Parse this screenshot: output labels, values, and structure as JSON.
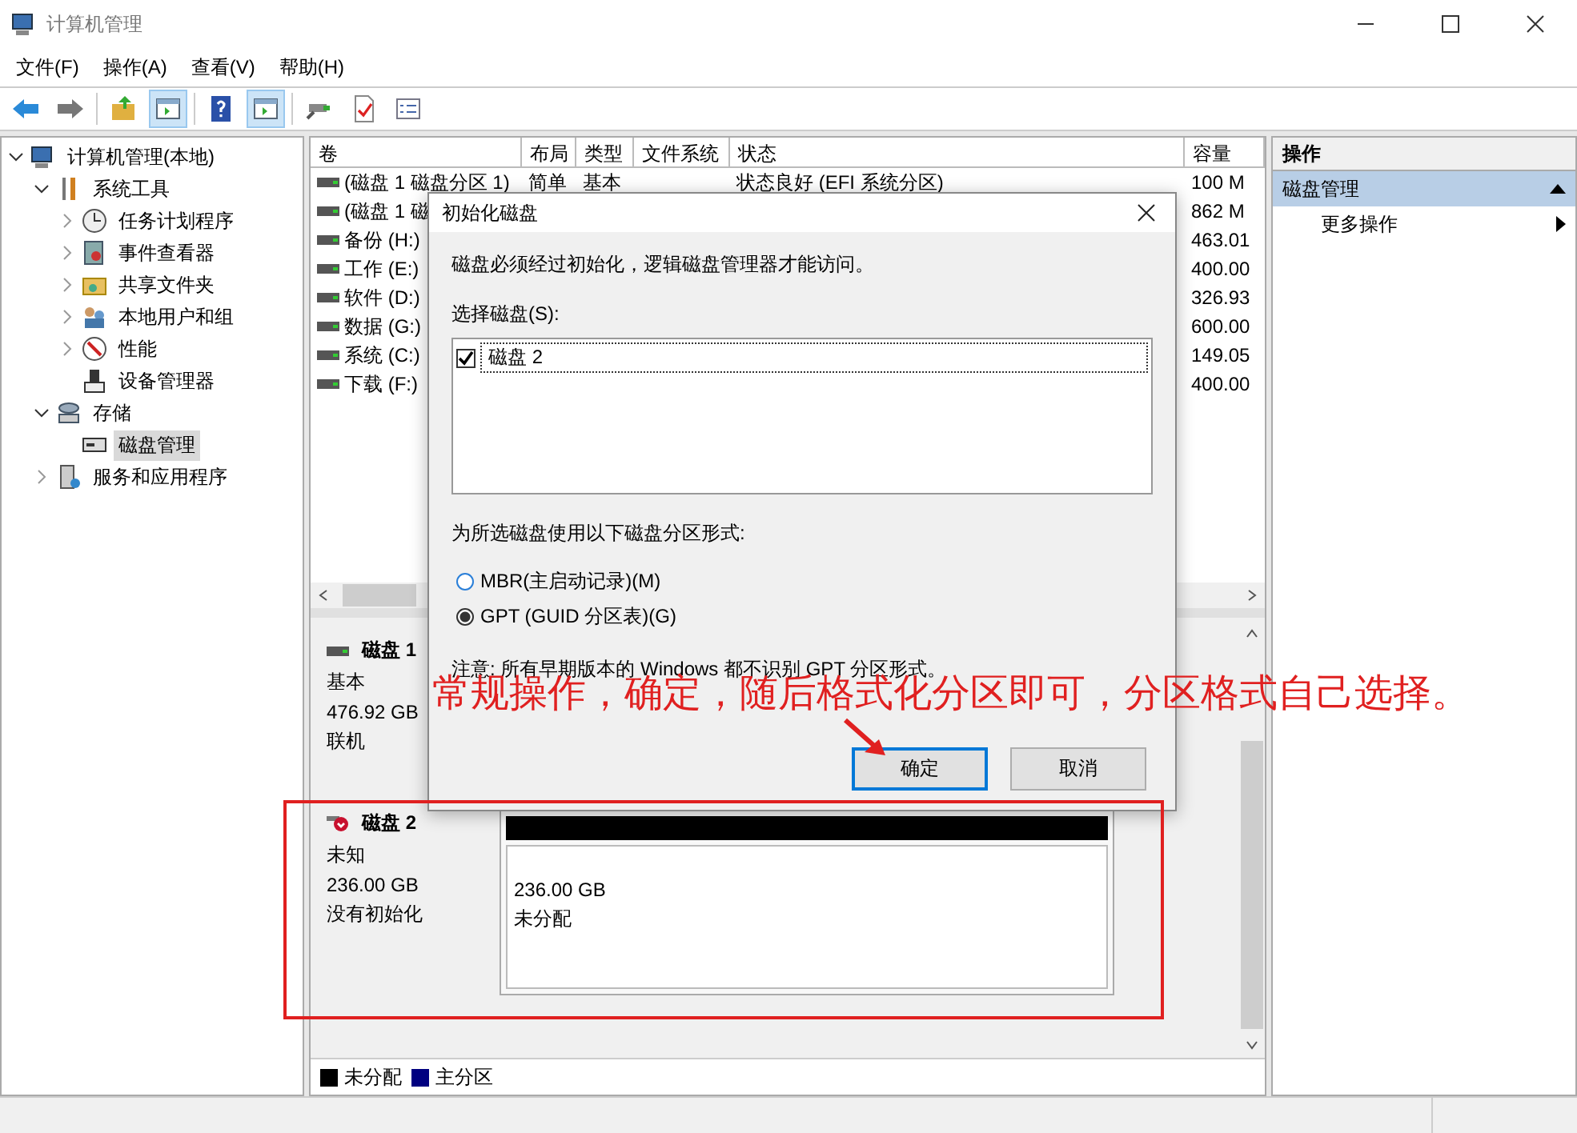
{
  "window": {
    "title": "计算机管理"
  },
  "menu": [
    "文件(F)",
    "操作(A)",
    "查看(V)",
    "帮助(H)"
  ],
  "toolbar": [
    {
      "kind": "back",
      "pressed": false
    },
    {
      "kind": "forward",
      "pressed": false
    },
    {
      "kind": "up",
      "pressed": false
    },
    {
      "kind": "pane",
      "pressed": true
    },
    {
      "kind": "help",
      "pressed": false
    },
    {
      "kind": "pane",
      "pressed": true
    },
    {
      "kind": "connect",
      "pressed": false
    },
    {
      "kind": "check",
      "pressed": false
    },
    {
      "kind": "list",
      "pressed": false
    }
  ],
  "tree": [
    {
      "label": "计算机管理(本地)",
      "kind": "computer",
      "selected": false,
      "expanded": true,
      "children": [
        {
          "label": "系统工具",
          "kind": "tools",
          "selected": false,
          "expanded": true,
          "children": [
            {
              "label": "任务计划程序",
              "kind": "clock",
              "selected": false,
              "expanded": false
            },
            {
              "label": "事件查看器",
              "kind": "log",
              "selected": false,
              "expanded": false
            },
            {
              "label": "共享文件夹",
              "kind": "folder",
              "selected": false,
              "expanded": false
            },
            {
              "label": "本地用户和组",
              "kind": "users",
              "selected": false,
              "expanded": false
            },
            {
              "label": "性能",
              "kind": "gauge",
              "selected": false,
              "expanded": false
            },
            {
              "label": "设备管理器",
              "kind": "device",
              "selected": false
            }
          ]
        },
        {
          "label": "存储",
          "kind": "storage",
          "selected": false,
          "expanded": true,
          "children": [
            {
              "label": "磁盘管理",
              "kind": "disk",
              "selected": true
            }
          ]
        },
        {
          "label": "服务和应用程序",
          "kind": "services",
          "selected": false,
          "expanded": false
        }
      ]
    }
  ],
  "table": {
    "columns": [
      "卷",
      "布局",
      "类型",
      "文件系统",
      "状态",
      "容量"
    ],
    "rows": [
      {
        "volume": "(磁盘 1 磁盘分区 1)",
        "layout": "简单",
        "type": "基本",
        "status": "状态良好 (EFI 系统分区)",
        "capacity": "100 M"
      },
      {
        "volume": "(磁盘 1 磁",
        "capacity": "862 M"
      },
      {
        "volume": "备份 (H:)",
        "capacity": "463.01"
      },
      {
        "volume": "工作 (E:)",
        "capacity": "400.00"
      },
      {
        "volume": "软件 (D:)",
        "capacity": "326.93"
      },
      {
        "volume": "数据 (G:)",
        "capacity": "600.00"
      },
      {
        "volume": "系统 (C:)",
        "capacity": "149.05"
      },
      {
        "volume": "下载 (F:)",
        "capacity": "400.00"
      }
    ]
  },
  "disks": [
    {
      "name": "磁盘 1",
      "kind": "basic",
      "lines": [
        "基本",
        "476.92 GB",
        "联机"
      ]
    },
    {
      "name": "磁盘 2",
      "kind": "uninitialized",
      "lines": [
        "未知",
        "236.00 GB",
        "没有初始化"
      ],
      "partitions": [
        {
          "size": "236.00 GB",
          "label": "未分配",
          "color": "#000000"
        }
      ]
    }
  ],
  "legend": [
    {
      "label": "未分配",
      "color": "#000000"
    },
    {
      "label": "主分区",
      "color": "#000080"
    }
  ],
  "actions": {
    "header": "操作",
    "items": [
      {
        "label": "磁盘管理",
        "kind": "section",
        "expanded": true
      },
      {
        "label": "更多操作",
        "kind": "submenu"
      }
    ]
  },
  "dialog": {
    "title": "初始化磁盘",
    "message": "磁盘必须经过初始化，逻辑磁盘管理器才能访问。",
    "select_label": "选择磁盘(S):",
    "disks": [
      {
        "label": "磁盘 2",
        "checked": true
      }
    ],
    "style_label": "为所选磁盘使用以下磁盘分区形式:",
    "options": [
      {
        "label": "MBR(主启动记录)(M)",
        "selected": false
      },
      {
        "label": "GPT (GUID 分区表)(G)",
        "selected": true
      }
    ],
    "note": "注意: 所有早期版本的 Windows 都不识别 GPT 分区形式。",
    "buttons": [
      {
        "label": "确定",
        "default": true
      },
      {
        "label": "取消",
        "default": false
      }
    ]
  },
  "annotation": {
    "text": "常规操作，确定，随后格式化分区即可，分区格式自己选择。"
  }
}
